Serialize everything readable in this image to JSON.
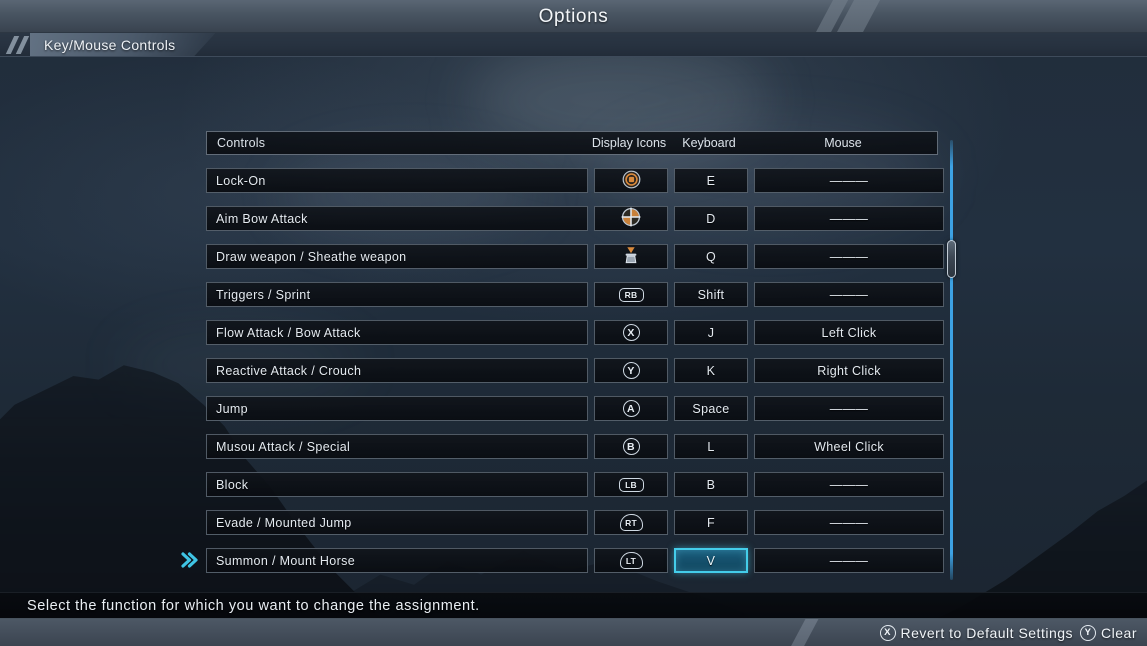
{
  "titlebar": {
    "title": "Options"
  },
  "tabbar": {
    "active_tab": "Key/Mouse Controls"
  },
  "table": {
    "headers": {
      "controls": "Controls",
      "display_icons": "Display Icons",
      "keyboard": "Keyboard",
      "mouse": "Mouse"
    },
    "rows": [
      {
        "name": "Lock-On",
        "icon": "lock-on-target-icon",
        "icon_label": "",
        "key": "E",
        "mouse": "———",
        "selected": false
      },
      {
        "name": "Aim Bow Attack",
        "icon": "crosshair-icon",
        "icon_label": "",
        "key": "D",
        "mouse": "———",
        "selected": false
      },
      {
        "name": "Draw weapon / Sheathe weapon",
        "icon": "draw-weapon-icon",
        "icon_label": "",
        "key": "Q",
        "mouse": "———",
        "selected": false
      },
      {
        "name": "Triggers / Sprint",
        "icon": "bumper-button-icon",
        "icon_label": "RB",
        "key": "Shift",
        "mouse": "———",
        "selected": false
      },
      {
        "name": "Flow Attack / Bow Attack",
        "icon": "face-button-icon",
        "icon_label": "X",
        "key": "J",
        "mouse": "Left Click",
        "selected": false
      },
      {
        "name": "Reactive Attack / Crouch",
        "icon": "face-button-icon",
        "icon_label": "Y",
        "key": "K",
        "mouse": "Right Click",
        "selected": false
      },
      {
        "name": "Jump",
        "icon": "face-button-icon",
        "icon_label": "A",
        "key": "Space",
        "mouse": "———",
        "selected": false
      },
      {
        "name": "Musou Attack / Special",
        "icon": "face-button-icon",
        "icon_label": "B",
        "key": "L",
        "mouse": "Wheel Click",
        "selected": false
      },
      {
        "name": "Block",
        "icon": "bumper-button-icon",
        "icon_label": "LB",
        "key": "B",
        "mouse": "———",
        "selected": false
      },
      {
        "name": "Evade / Mounted Jump",
        "icon": "trigger-button-icon",
        "icon_label": "RT",
        "key": "F",
        "mouse": "———",
        "selected": false
      },
      {
        "name": "Summon / Mount Horse",
        "icon": "trigger-button-icon",
        "icon_label": "LT",
        "key": "V",
        "mouse": "———",
        "selected": true
      }
    ]
  },
  "description": {
    "text": "Select the function for which you want to change the assignment."
  },
  "footer": {
    "hints": [
      {
        "button": "X",
        "label": "Revert to Default Settings"
      },
      {
        "button": "Y",
        "label": "Clear"
      }
    ]
  },
  "colors": {
    "accent_cyan": "#44cdea",
    "scrollbar_blue": "#3da2e4",
    "icon_orange": "#d98a3c",
    "background_navy": "#212d3b"
  }
}
